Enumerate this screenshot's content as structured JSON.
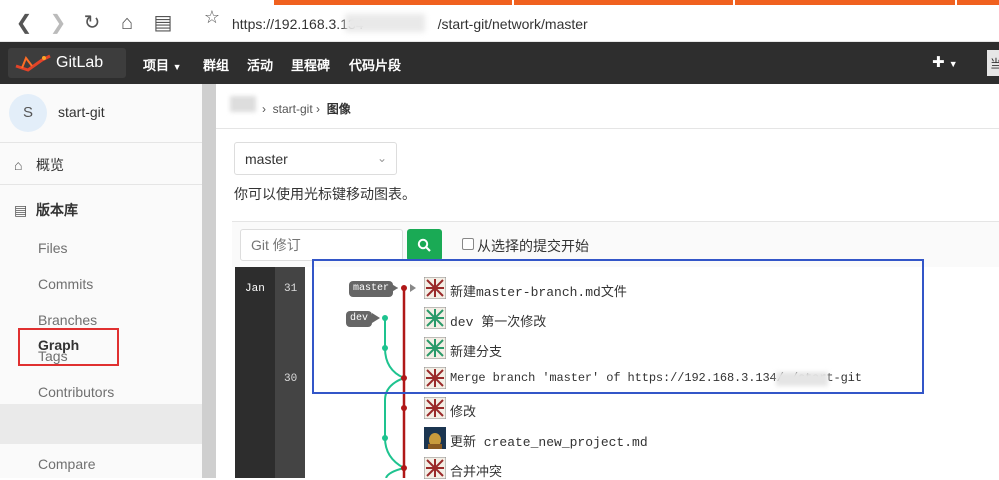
{
  "browser": {
    "url": "https://192.168.3.134/        /start-git/network/master",
    "url_left": "https://192.168.3.134",
    "url_right": "/start-git/network/master"
  },
  "header": {
    "brand": "GitLab",
    "menu": [
      "项目",
      "群组",
      "活动",
      "里程碑",
      "代码片段"
    ],
    "user_label": "当"
  },
  "sidebar": {
    "avatar_letter": "S",
    "project_name": "start-git",
    "overview": "概览",
    "repository": "版本库",
    "items": [
      "Files",
      "Commits",
      "Branches",
      "Tags",
      "Contributors",
      "Graph",
      "Compare"
    ]
  },
  "breadcrumb": {
    "project": "start-git",
    "current": "图像"
  },
  "graph_page": {
    "branch_select": "master",
    "hint": "你可以使用光标键移动图表。",
    "search_placeholder": "Git 修订",
    "start_from_selected": "从选择的提交开始",
    "month": "Jan",
    "days": [
      "31",
      "30"
    ],
    "labels": {
      "master": "master",
      "dev": "dev"
    },
    "commits": [
      "新建master-branch.md文件",
      "dev 第一次修改",
      "新建分支",
      "Merge branch 'master' of https://192.168.3.134/        /start-git",
      "修改",
      "更新 create_new_project.md",
      "合并冲突"
    ],
    "colors": {
      "master_line": "#b01818",
      "dev_line": "#1ec38f"
    }
  }
}
